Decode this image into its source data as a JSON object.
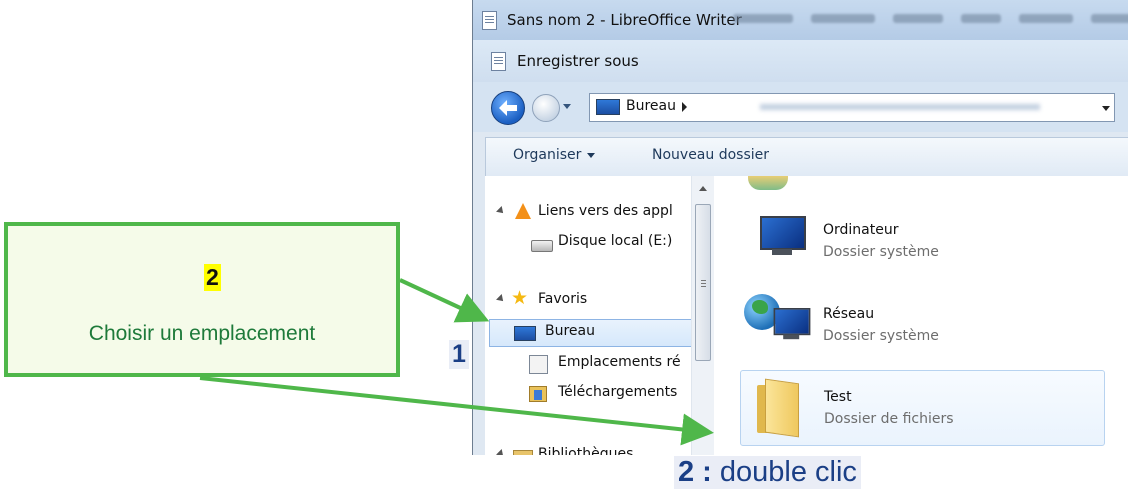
{
  "window": {
    "title": "Sans nom 2 - LibreOffice Writer"
  },
  "dialog": {
    "title": "Enregistrer sous"
  },
  "address": {
    "location": "Bureau"
  },
  "toolbar": {
    "organiser": "Organiser",
    "new_folder": "Nouveau dossier"
  },
  "nav": {
    "items": [
      {
        "label": "Liens vers des appl",
        "icon": "vlc-icon"
      },
      {
        "label": "Disque local (E:)",
        "icon": "drive-icon"
      },
      {
        "label": "Favoris",
        "icon": "star-icon"
      },
      {
        "label": "Bureau",
        "icon": "desktop-icon",
        "selected": true
      },
      {
        "label": "Emplacements ré",
        "icon": "places-icon"
      },
      {
        "label": "Téléchargements",
        "icon": "downloads-icon"
      },
      {
        "label": "Bibliothèques",
        "icon": "library-icon"
      }
    ]
  },
  "files": [
    {
      "name": "Ordinateur",
      "type": "Dossier système",
      "icon": "computer-icon"
    },
    {
      "name": "Réseau",
      "type": "Dossier système",
      "icon": "network-icon"
    },
    {
      "name": "Test",
      "type": "Dossier de fichiers",
      "icon": "folder-icon"
    }
  ],
  "annotations": {
    "callout_number": "2",
    "callout_text": "Choisir un emplacement",
    "step1": "1",
    "step2_number": "2 :",
    "step2_text": "double clic",
    "colors": {
      "arrow": "#4fb74a",
      "label_text": "#1b3f86",
      "highlight": "#ffff00"
    }
  }
}
